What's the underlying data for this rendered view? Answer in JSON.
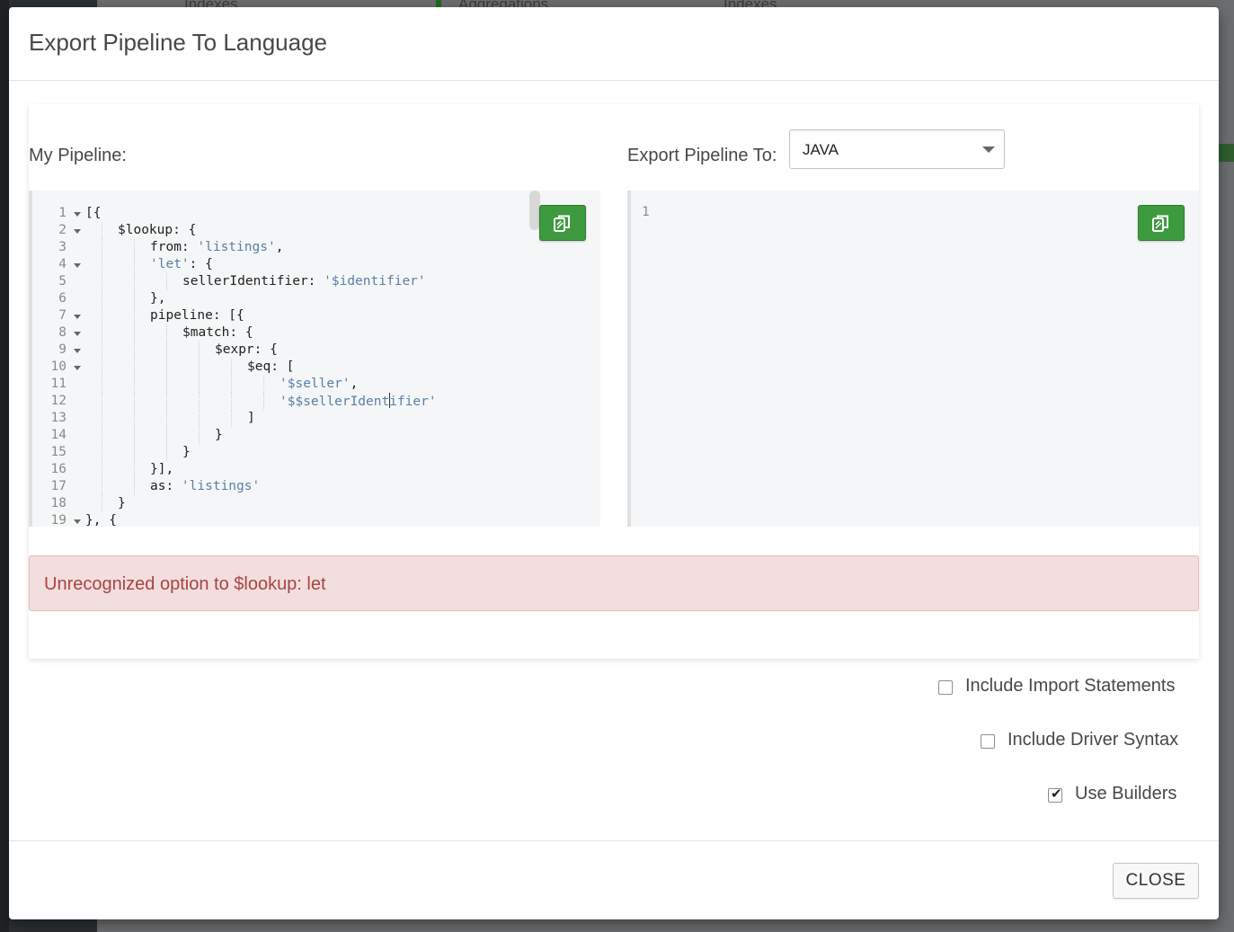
{
  "background": {
    "tabs": [
      "Indexes",
      "Aggregations",
      "Indexes"
    ]
  },
  "modal": {
    "title": "Export Pipeline To Language",
    "my_pipeline_label": "My Pipeline:",
    "export_to_label": "Export Pipeline To:",
    "language_select": {
      "selected": "JAVA"
    },
    "editor": {
      "lines": [
        {
          "n": "1",
          "fold": true,
          "indent": 0,
          "parts": [
            [
              "t",
              "[{"
            ]
          ]
        },
        {
          "n": "2",
          "fold": true,
          "indent": 1,
          "parts": [
            [
              "t",
              "$lookup: {"
            ]
          ]
        },
        {
          "n": "3",
          "fold": false,
          "indent": 2,
          "parts": [
            [
              "t",
              "from: "
            ],
            [
              "s",
              "'listings'"
            ],
            [
              "t",
              ","
            ]
          ]
        },
        {
          "n": "4",
          "fold": true,
          "indent": 2,
          "parts": [
            [
              "s",
              "'let'"
            ],
            [
              "t",
              ": {"
            ]
          ]
        },
        {
          "n": "5",
          "fold": false,
          "indent": 3,
          "parts": [
            [
              "t",
              "sellerIdentifier: "
            ],
            [
              "s",
              "'$identifier'"
            ]
          ]
        },
        {
          "n": "6",
          "fold": false,
          "indent": 2,
          "parts": [
            [
              "t",
              "},"
            ]
          ]
        },
        {
          "n": "7",
          "fold": true,
          "indent": 2,
          "parts": [
            [
              "t",
              "pipeline: [{"
            ]
          ]
        },
        {
          "n": "8",
          "fold": true,
          "indent": 3,
          "parts": [
            [
              "t",
              "$match: {"
            ]
          ]
        },
        {
          "n": "9",
          "fold": true,
          "indent": 4,
          "parts": [
            [
              "t",
              "$expr: {"
            ]
          ]
        },
        {
          "n": "10",
          "fold": true,
          "indent": 5,
          "parts": [
            [
              "t",
              "$eq: ["
            ]
          ]
        },
        {
          "n": "11",
          "fold": false,
          "indent": 6,
          "parts": [
            [
              "s",
              "'$seller'"
            ],
            [
              "t",
              ","
            ]
          ]
        },
        {
          "n": "12",
          "fold": false,
          "indent": 6,
          "parts": [
            [
              "s",
              "'$$sellerIdent"
            ],
            [
              "c",
              ""
            ],
            [
              "s",
              "ifier'"
            ]
          ]
        },
        {
          "n": "13",
          "fold": false,
          "indent": 5,
          "parts": [
            [
              "t",
              "]"
            ]
          ]
        },
        {
          "n": "14",
          "fold": false,
          "indent": 4,
          "parts": [
            [
              "t",
              "}"
            ]
          ]
        },
        {
          "n": "15",
          "fold": false,
          "indent": 3,
          "parts": [
            [
              "t",
              "}"
            ]
          ]
        },
        {
          "n": "16",
          "fold": false,
          "indent": 2,
          "parts": [
            [
              "t",
              "}],"
            ]
          ]
        },
        {
          "n": "17",
          "fold": false,
          "indent": 2,
          "parts": [
            [
              "t",
              "as: "
            ],
            [
              "s",
              "'listings'"
            ]
          ]
        },
        {
          "n": "18",
          "fold": false,
          "indent": 1,
          "parts": [
            [
              "t",
              "}"
            ]
          ]
        },
        {
          "n": "19",
          "fold": true,
          "indent": 0,
          "parts": [
            [
              "t",
              "}, {"
            ]
          ]
        }
      ]
    },
    "output_editor": {
      "line_number": "1"
    },
    "error_message": "Unrecognized option to $lookup: let",
    "options": [
      {
        "label": "Include Import Statements",
        "checked": false
      },
      {
        "label": "Include Driver Syntax",
        "checked": false
      },
      {
        "label": "Use Builders",
        "checked": true
      }
    ],
    "close_label": "CLOSE"
  }
}
